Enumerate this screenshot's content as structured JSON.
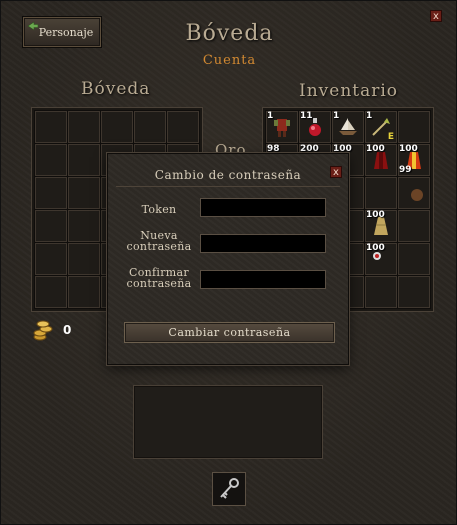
{
  "window": {
    "title": "Bóveda",
    "subtitle": "Cuenta",
    "close_label": "x"
  },
  "personaje_button": {
    "label": "Personaje",
    "icon": "arrow-icon"
  },
  "vault": {
    "title": "Bóveda",
    "gold": {
      "label": "0",
      "icon": "gold-coins-icon"
    }
  },
  "oro_label": "Oro",
  "inventory": {
    "title": "Inventario",
    "slots": [
      {
        "qty": "1",
        "icon": "red-armor-icon"
      },
      {
        "qty": "11",
        "icon": "red-potion-icon"
      },
      {
        "qty": "1",
        "icon": "boat-icon"
      },
      {
        "qty": "1",
        "icon": "arrow-icon",
        "mark": "E"
      },
      {
        "qty": "",
        "icon": ""
      },
      {
        "qty": "98",
        "icon": "chain-icon"
      },
      {
        "qty": "200",
        "icon": "scroll-icon"
      },
      {
        "qty": "100",
        "icon": "item-icon"
      },
      {
        "qty": "100",
        "icon": "red-robe-icon"
      },
      {
        "qty": "100",
        "icon": "fire-robe-icon",
        "qty2": "99"
      },
      {
        "qty": "",
        "icon": ""
      },
      {
        "qty": "",
        "icon": ""
      },
      {
        "qty": "",
        "icon": ""
      },
      {
        "qty": "",
        "icon": ""
      },
      {
        "qty": "",
        "icon": "bag-icon"
      },
      {
        "qty": "",
        "icon": ""
      },
      {
        "qty": "",
        "icon": ""
      },
      {
        "qty": "",
        "icon": "item-icon"
      },
      {
        "qty": "100",
        "icon": "dress-icon"
      },
      {
        "qty": "",
        "icon": ""
      },
      {
        "qty": "",
        "icon": ""
      },
      {
        "qty": "",
        "icon": ""
      },
      {
        "qty": "",
        "icon": "figure-icon"
      },
      {
        "qty": "100",
        "icon": "mask-icon"
      },
      {
        "qty": "",
        "icon": ""
      },
      {
        "qty": "",
        "icon": ""
      },
      {
        "qty": "",
        "icon": ""
      },
      {
        "qty": "",
        "icon": ""
      },
      {
        "qty": "",
        "icon": ""
      },
      {
        "qty": "",
        "icon": ""
      }
    ]
  },
  "password_dialog": {
    "title": "Cambio de contraseña",
    "close_label": "x",
    "token_label": "Token",
    "new_password_label_1": "Nueva",
    "new_password_label_2": "contraseña",
    "confirm_password_label_1": "Confirmar",
    "confirm_password_label_2": "contraseña",
    "token_value": "",
    "new_password_value": "",
    "confirm_password_value": "",
    "submit_label": "Cambiar contraseña"
  },
  "key_slot": {
    "icon": "key-icon"
  },
  "colors": {
    "accent": "#d38a32",
    "title": "#b9ab93"
  }
}
